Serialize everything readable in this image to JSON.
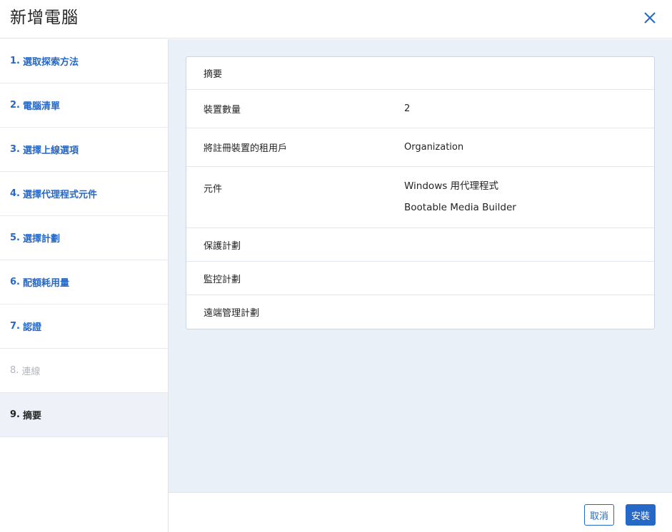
{
  "dialog": {
    "title": "新增電腦"
  },
  "steps": [
    {
      "number": "1.",
      "label": "選取探索方法"
    },
    {
      "number": "2.",
      "label": "電腦清單"
    },
    {
      "number": "3.",
      "label": "選擇上線選項"
    },
    {
      "number": "4.",
      "label": "選擇代理程式元件"
    },
    {
      "number": "5.",
      "label": "選擇計劃"
    },
    {
      "number": "6.",
      "label": "配額耗用量"
    },
    {
      "number": "7.",
      "label": "認證"
    },
    {
      "number": "8.",
      "label": "連線"
    },
    {
      "number": "9.",
      "label": "摘要"
    }
  ],
  "summary": {
    "heading": "摘要",
    "device_count": {
      "label": "裝置數量",
      "value": "2"
    },
    "tenant": {
      "label": "將註冊裝置的租用戶",
      "value": "Organization"
    },
    "components": {
      "label": "元件",
      "values": [
        "Windows 用代理程式",
        "Bootable Media Builder"
      ]
    },
    "protection_plan": {
      "label": "保護計劃"
    },
    "monitoring_plan": {
      "label": "監控計劃"
    },
    "remote_management_plan": {
      "label": "遠端管理計劃"
    }
  },
  "footer": {
    "cancel_label": "取消",
    "install_label": "安裝"
  },
  "colors": {
    "accent": "#2668c5",
    "main_bg": "#eaf0f8",
    "disabled": "#b3b7bd"
  },
  "icons": {
    "close": "close-icon"
  }
}
